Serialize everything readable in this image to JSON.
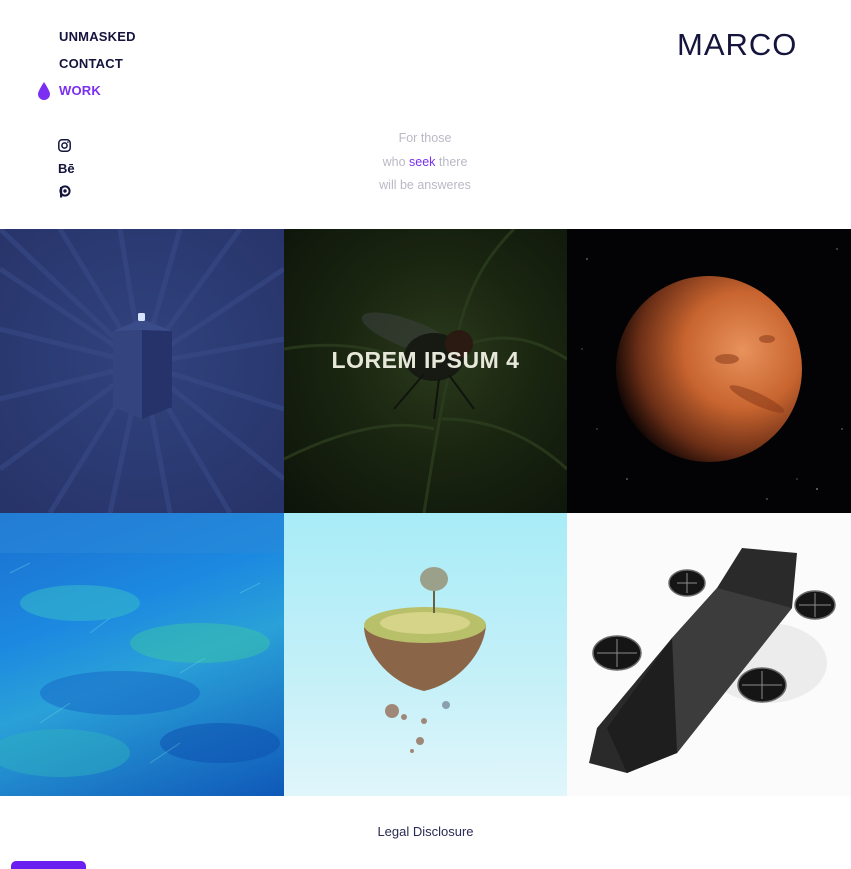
{
  "nav": {
    "items": [
      {
        "label": "UNMASKED"
      },
      {
        "label": "CONTACT"
      },
      {
        "label": "WORK"
      }
    ]
  },
  "social": {
    "behance_label": "Bē"
  },
  "logo": {
    "text": "MARCO"
  },
  "tagline": {
    "line1": "For those",
    "line2_pre": "who",
    "line2_highlight": "seek",
    "line2_post": "there",
    "line3": "will be answeres"
  },
  "gallery": {
    "tiles": [
      {
        "name": "blue-box"
      },
      {
        "name": "fly-on-leaf",
        "title": "LOREM IPSUM 4"
      },
      {
        "name": "mars"
      },
      {
        "name": "blue-grass"
      },
      {
        "name": "floating-island"
      },
      {
        "name": "spaceship"
      }
    ]
  },
  "footer": {
    "legal_label": "Legal Disclosure"
  },
  "colors": {
    "accent": "#7b2ff2",
    "text": "#14143c",
    "muted": "#b9b9c6"
  }
}
